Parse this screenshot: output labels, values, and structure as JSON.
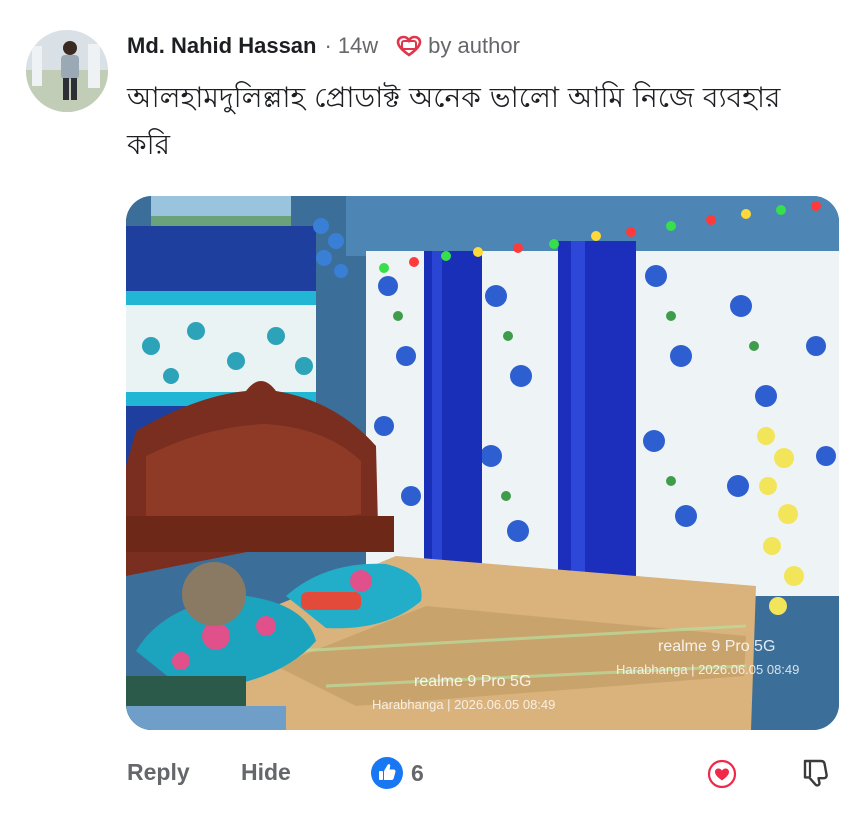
{
  "comment": {
    "author": "Md. Nahid Hassan",
    "separator": "·",
    "time": "14w",
    "badge_label": "by author",
    "text": "আলহামদুলিল্লাহ প্রোডাক্ট অনেক ভালো আমি নিজে ব্যবহার করি"
  },
  "photo": {
    "watermark_1": {
      "device": "realme 9 Pro 5G",
      "info": "Harabhanga | 2026.06.05 08:49"
    },
    "watermark_2": {
      "device": "realme 9 Pro 5G",
      "info": "Harabhanga | 2026.06.05 08:49"
    }
  },
  "actions": {
    "reply_label": "Reply",
    "hide_label": "Hide",
    "like_count": "6"
  },
  "icons": {
    "badge": "heart-outline-icon",
    "like": "thumbs-up-icon",
    "react": "heart-react-icon",
    "dislike": "thumbs-down-icon"
  },
  "colors": {
    "accent_blue": "#1877f2",
    "heart_red": "#f0284a",
    "muted_text": "#65676b"
  }
}
